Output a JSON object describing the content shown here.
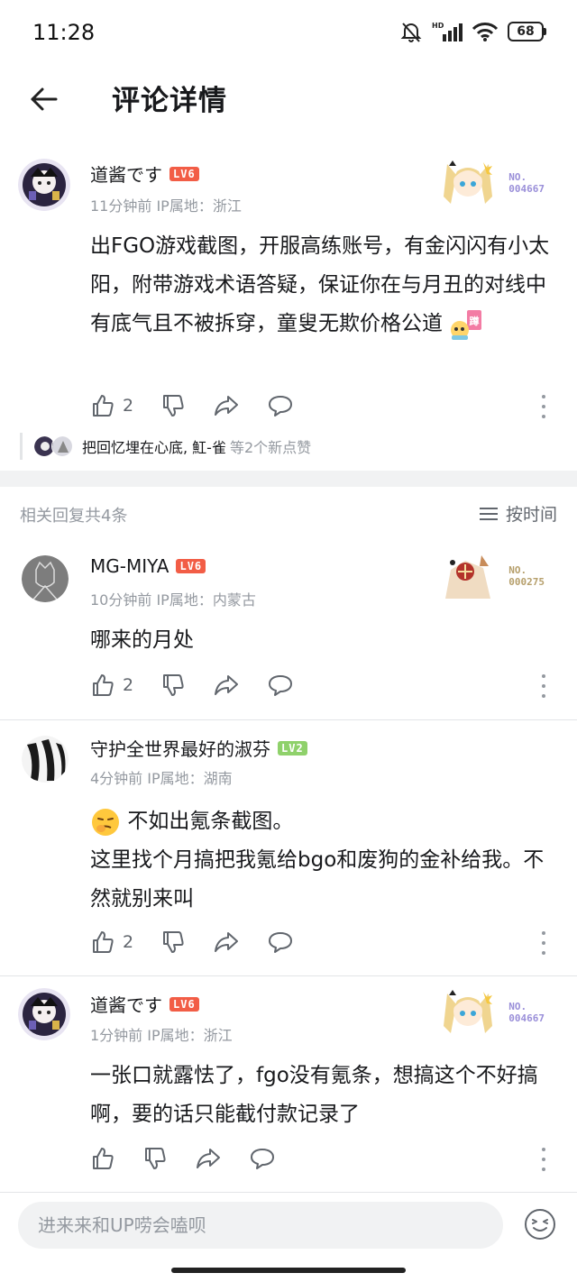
{
  "status_bar": {
    "time": "11:28",
    "battery": "68",
    "network": "HD"
  },
  "header": {
    "title": "评论详情",
    "back_icon": "arrow-left-icon"
  },
  "main_comment": {
    "username": "道酱です",
    "level": "LV6",
    "time_location": "11分钟前 IP属地：浙江",
    "text": "出FGO游戏截图，开服高练账号，有金闪闪有小太阳，附带游戏术语答疑，保证你在与月丑的对线中有底气且不被拆穿，童叟无欺价格公道",
    "fan_no_label": "NO.",
    "fan_no": "004667",
    "likes": "2",
    "liked_by_names": "把回忆埋在心底, 魟-雀",
    "liked_by_suffix": "等2个新点赞"
  },
  "replies_header": {
    "count_label": "相关回复共4条",
    "sort_label": "按时间"
  },
  "replies": [
    {
      "username": "MG-MIYA",
      "level": "LV6",
      "time_location": "10分钟前 IP属地：内蒙古",
      "text": "哪来的月处",
      "fan_no_label": "NO.",
      "fan_no": "000275",
      "likes": "2"
    },
    {
      "username": "守护全世界最好的淑芬",
      "level": "LV2",
      "time_location": "4分钟前 IP属地：湖南",
      "text_line1": "不如出氪条截图。",
      "text_rest": "这里找个月搞把我氪给bgo和废狗的金补给我。不然就别来叫",
      "likes": "2"
    },
    {
      "username": "道酱です",
      "level": "LV6",
      "time_location": "1分钟前 IP属地：浙江",
      "text": "一张口就露怯了，fgo没有氪条，想搞这个不好搞啊，要的话只能截付款记录了",
      "fan_no_label": "NO.",
      "fan_no": "004667",
      "likes": ""
    }
  ],
  "input_bar": {
    "placeholder": "进来来和UP唠会嗑呗"
  },
  "colors": {
    "accent": "#fb7299",
    "level6": "#f25d46",
    "level2": "#8fd16b",
    "meta": "#9499a0",
    "fan_no": "#9a8fd9"
  }
}
